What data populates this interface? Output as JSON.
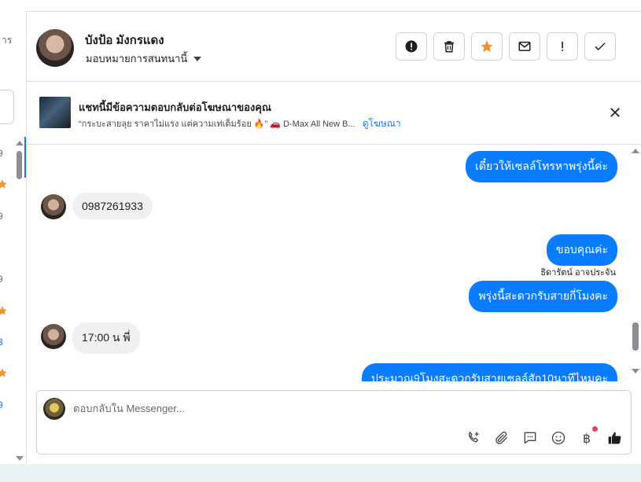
{
  "sidebar_fragment": {
    "text_frags": [
      "าร",
      "9",
      "9",
      "9",
      "3",
      "9"
    ]
  },
  "header": {
    "contact_name": "บังป้อ มังกรแดง",
    "assign_label": "มอบหมายการสนทนานี้",
    "action_icons": [
      "alert-circle-icon",
      "trash-icon",
      "star-icon",
      "mail-icon",
      "exclamation-icon",
      "check-icon"
    ]
  },
  "ad_banner": {
    "title": "แชทนี้มีข้อความตอบกลับต่อโฆษณาของคุณ",
    "subtitle": "“กระบะสายลุย ราคาไม่แรง แต่ความเท่เต็มร้อย 🔥” 🚗 D-Max All New B...",
    "link": "ดูโฆษณา"
  },
  "messages": [
    {
      "dir": "out",
      "text": "เดี๋ยวให้เซลล์โทรหาพรุ่งนี้ค่ะ"
    },
    {
      "dir": "in",
      "text": "0987261933"
    },
    {
      "dir": "out",
      "text": "ขอบคุณค่ะ"
    },
    {
      "dir": "out",
      "sender": "ธิดารัตน์ อาจประจัน",
      "text": "พรุ่งนี้สะดวกรับสายกี่โมงคะ"
    },
    {
      "dir": "in",
      "text": "17:00 น พี่"
    },
    {
      "dir": "out",
      "text": "ประมาณ9โมงสะดวกรับสายเซลล์สัก10นาทีไหมคะ"
    }
  ],
  "composer": {
    "placeholder": "ตอบกลับใน Messenger...",
    "baht_symbol": "฿",
    "tool_icons": [
      "call-add-icon",
      "paperclip-icon",
      "chat-bubble-icon",
      "emoji-icon",
      "baht-icon",
      "thumbs-up-icon"
    ]
  },
  "colors": {
    "accent": "#0a7cff",
    "link": "#1877f2",
    "star": "#f5922f",
    "notify_dot": "#e4405f"
  }
}
